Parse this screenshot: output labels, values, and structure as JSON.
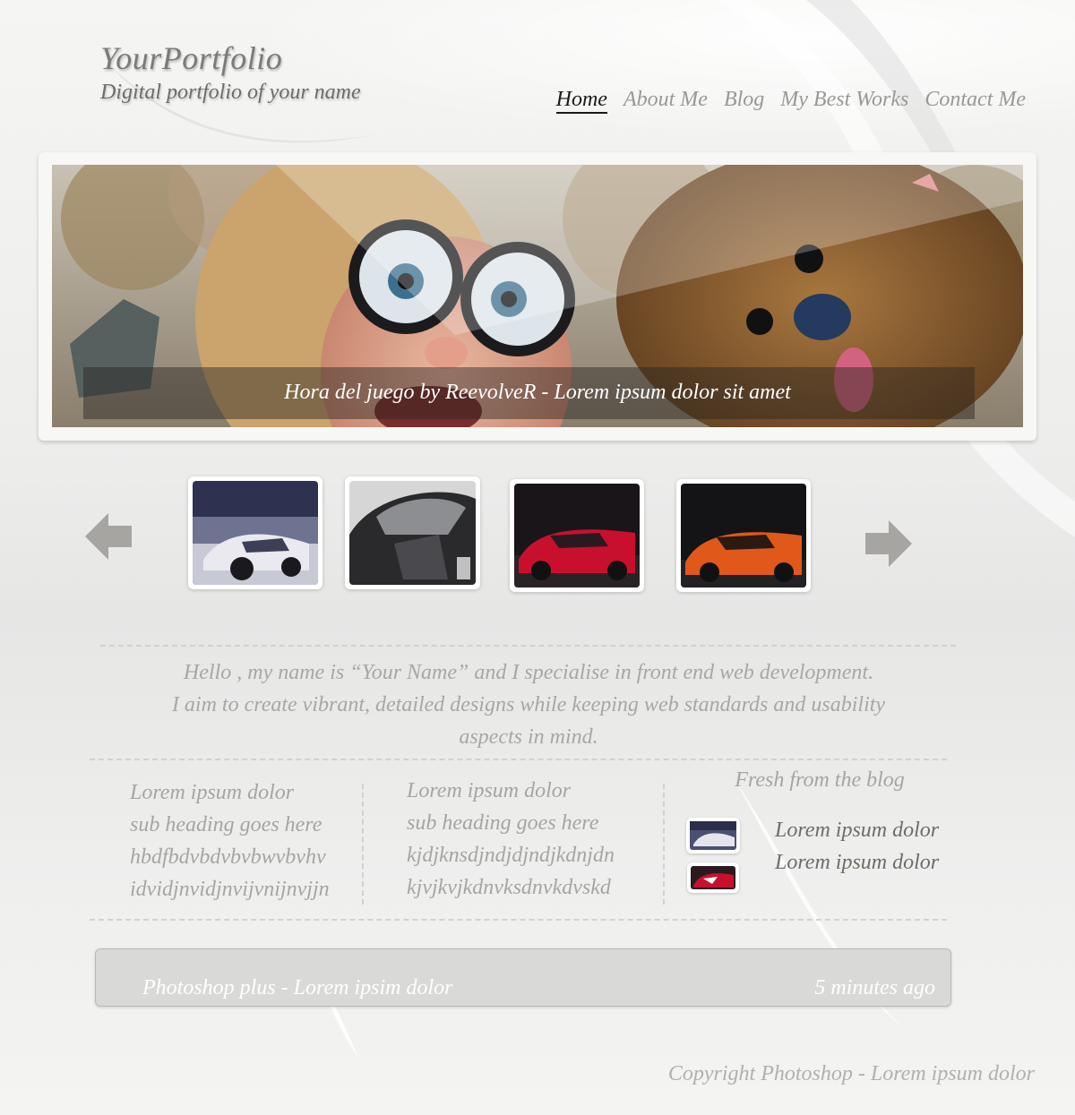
{
  "header": {
    "brand_title": "YourPortfolio",
    "brand_subtitle": "Digital portfolio of your name"
  },
  "nav": {
    "items": [
      {
        "label": "Home",
        "active": true
      },
      {
        "label": "About Me",
        "active": false
      },
      {
        "label": "Blog",
        "active": false
      },
      {
        "label": "My Best Works",
        "active": false
      },
      {
        "label": "Contact Me",
        "active": false
      }
    ]
  },
  "hero": {
    "caption": "Hora del juego by ReevolveR - Lorem ipsum dolor sit amet"
  },
  "carousel": {
    "prev_icon": "left-arrow-icon",
    "next_icon": "right-arrow-icon",
    "thumbnails": [
      "silver-concept-car",
      "black-supercar",
      "red-sports-car",
      "orange-sports-car"
    ]
  },
  "intro": {
    "line1": "Hello , my name is “Your Name”  and  I specialise in front end web development.",
    "line2": "I aim to create vibrant, detailed designs while keeping web standards and usability",
    "line3": "aspects in mind."
  },
  "columns": [
    {
      "lines": [
        "Lorem ipsum dolor",
        "sub heading goes here",
        "hbdfbdvbdvbvbwvbvhv",
        "idvidjnvidjnvijvnijnvjjn"
      ]
    },
    {
      "lines": [
        "Lorem ipsum dolor",
        "sub heading goes here",
        "kjdjknsdjndjdjndjkdnjdn",
        "kjvjkvjkdnvksdnvkdvskd"
      ]
    }
  ],
  "blog": {
    "title": "Fresh from the blog",
    "links": [
      "Lorem ipsum dolor",
      "Lorem ipsum dolor"
    ]
  },
  "bottom_bar": {
    "left": "Photoshop plus - Lorem ipsim dolor",
    "right": "5 minutes ago"
  },
  "footer": {
    "copyright": "Copyright Photoshop - Lorem ipsum dolor"
  },
  "colors": {
    "accent_text": "#9a9896",
    "active_nav": "#1a1a1a",
    "background": "#eeeeed"
  }
}
